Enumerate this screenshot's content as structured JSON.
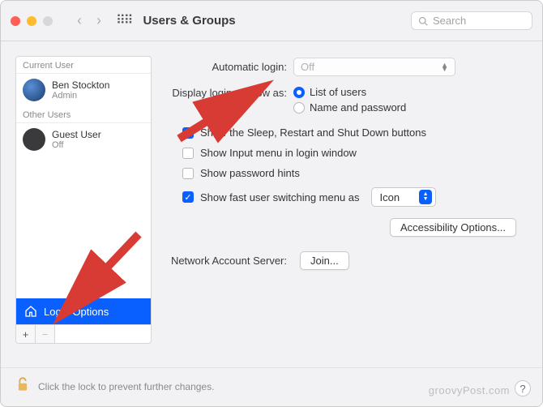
{
  "window": {
    "title": "Users & Groups"
  },
  "search": {
    "placeholder": "Search"
  },
  "sidebar": {
    "section_current": "Current User",
    "section_other": "Other Users",
    "current": {
      "name": "Ben Stockton",
      "role": "Admin"
    },
    "other": {
      "name": "Guest User",
      "role": "Off"
    },
    "login_options": "Login Options"
  },
  "main": {
    "auto_login_label": "Automatic login:",
    "auto_login_value": "Off",
    "display_label": "Display login window as:",
    "radio_list": "List of users",
    "radio_name": "Name and password",
    "chk_sleep": "Show the Sleep, Restart and Shut Down buttons",
    "chk_input": "Show Input menu in login window",
    "chk_hints": "Show password hints",
    "chk_fast": "Show fast user switching menu as",
    "fast_value": "Icon",
    "accessibility": "Accessibility Options...",
    "nas_label": "Network Account Server:",
    "join": "Join..."
  },
  "footer": {
    "lock_msg": "Click the lock to prevent further changes."
  },
  "watermark": "groovyPost.com"
}
